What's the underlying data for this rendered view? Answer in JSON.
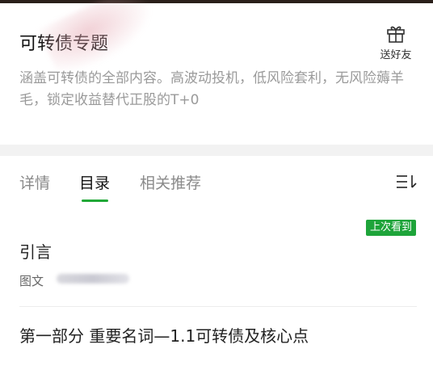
{
  "header": {
    "title": "可转债专题",
    "gift_label": "送好友",
    "description": "涵盖可转债的全部内容。高波动投机，低风险套利，无风险薅羊毛，锁定收益替代正股的T+0"
  },
  "tabs": [
    {
      "label": "详情",
      "active": false
    },
    {
      "label": "目录",
      "active": true
    },
    {
      "label": "相关推荐",
      "active": false
    }
  ],
  "menu_icon": "list-sort-icon",
  "catalog": {
    "badge": "上次看到",
    "items": [
      {
        "title": "引言",
        "type": "图文"
      },
      {
        "title": "第一部分 重要名词—1.1可转债及核心点"
      }
    ]
  },
  "colors": {
    "accent": "#21a837",
    "badge": "#1ea43a",
    "muted": "#9a9a9a"
  }
}
